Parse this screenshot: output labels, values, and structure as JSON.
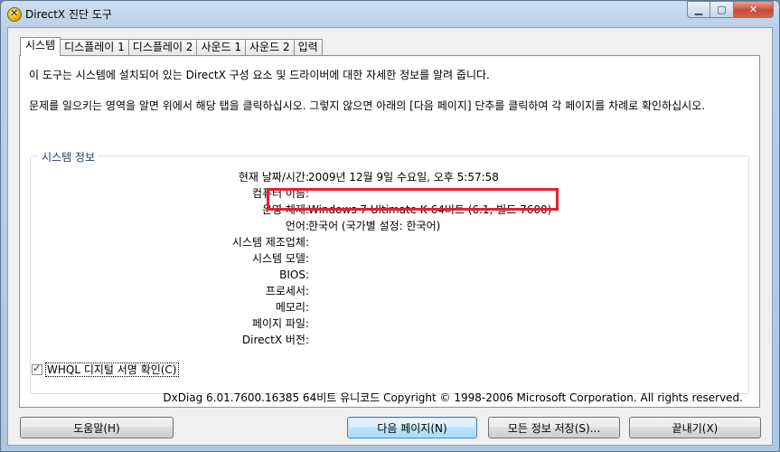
{
  "window": {
    "title": "DirectX 진단 도구"
  },
  "tabs": [
    {
      "label": "시스템"
    },
    {
      "label": "디스플레이 1"
    },
    {
      "label": "디스플레이 2"
    },
    {
      "label": "사운드 1"
    },
    {
      "label": "사운드 2"
    },
    {
      "label": "입력"
    }
  ],
  "intro": {
    "line1": "이 도구는 시스템에 설치되어 있는 DirectX 구성 요소 및 드라이버에 대한 자세한 정보를 알려 줍니다.",
    "line2": "문제를 일으키는 영역을 알면 위에서 해당 탭을 클릭하십시오. 그렇지 않으면 아래의 [다음 페이지] 단추를 클릭하여 각 페이지를 차례로 확인하십시오."
  },
  "system_info": {
    "group_label": "시스템 정보",
    "rows": [
      {
        "key": "현재 날짜/시간:",
        "value": "2009년 12월 9일 수요일, 오후 5:57:58"
      },
      {
        "key": "컴퓨터 이름:",
        "value": ""
      },
      {
        "key": "운영 체제:",
        "value": "Windows 7 Ultimate K 64비트 (6.1, 빌드 7600)"
      },
      {
        "key": "언어:",
        "value": "한국어 (국가별 설정: 한국어)"
      },
      {
        "key": "시스템 제조업체:",
        "value": ""
      },
      {
        "key": "시스템 모델:",
        "value": ""
      },
      {
        "key": "BIOS:",
        "value": ""
      },
      {
        "key": "프로세서:",
        "value": ""
      },
      {
        "key": "메모리:",
        "value": ""
      },
      {
        "key": "페이지 파일:",
        "value": ""
      },
      {
        "key": "DirectX 버전:",
        "value": ""
      }
    ]
  },
  "whql": {
    "label": "WHQL 디지털 서명 확인(C)",
    "checked": true
  },
  "footer": {
    "text": "DxDiag 6.01.7600.16385 64비트 유니코드  Copyright © 1998-2006 Microsoft Corporation.  All rights reserved."
  },
  "buttons": {
    "help": "도움말(H)",
    "next_page": "다음 페이지(N)",
    "save_all": "모든 정보 저장(S)...",
    "exit": "끝내기(X)"
  }
}
